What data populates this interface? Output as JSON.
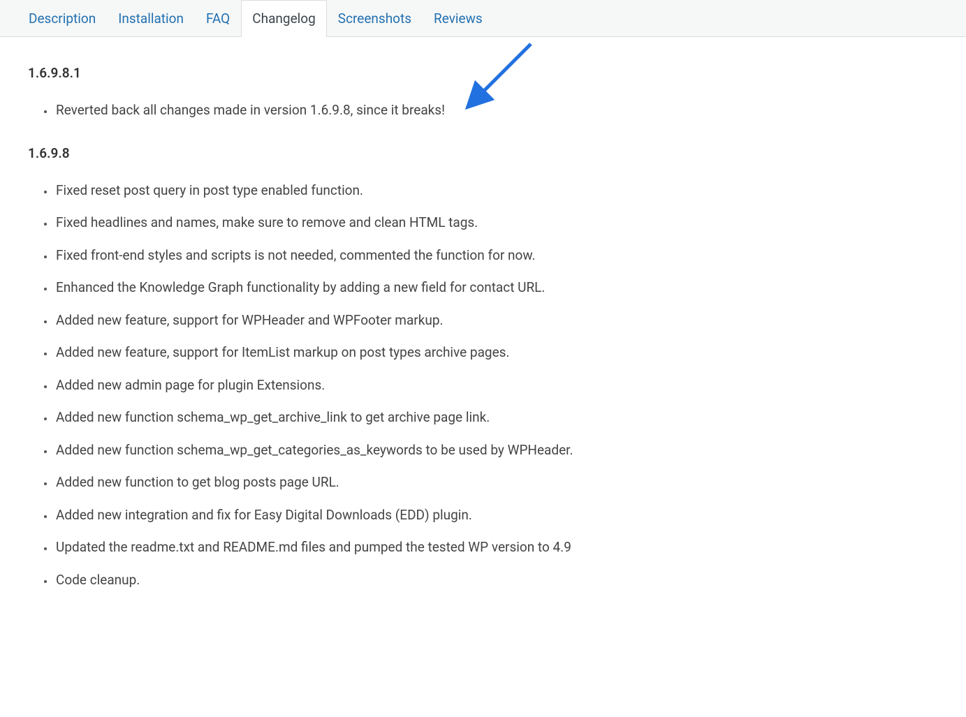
{
  "tabs": [
    {
      "label": "Description",
      "active": false
    },
    {
      "label": "Installation",
      "active": false
    },
    {
      "label": "FAQ",
      "active": false
    },
    {
      "label": "Changelog",
      "active": true
    },
    {
      "label": "Screenshots",
      "active": false
    },
    {
      "label": "Reviews",
      "active": false
    }
  ],
  "versions": [
    {
      "version": "1.6.9.8.1",
      "changes": [
        "Reverted back all changes made in version 1.6.9.8, since it breaks!"
      ]
    },
    {
      "version": "1.6.9.8",
      "changes": [
        "Fixed reset post query in post type enabled function.",
        "Fixed headlines and names, make sure to remove and clean HTML tags.",
        "Fixed front-end styles and scripts is not needed, commented the function for now.",
        "Enhanced the Knowledge Graph functionality by adding a new field for contact URL.",
        "Added new feature, support for WPHeader and WPFooter markup.",
        "Added new feature, support for ItemList markup on post types archive pages.",
        "Added new admin page for plugin Extensions.",
        "Added new function schema_wp_get_archive_link to get archive page link.",
        "Added new function schema_wp_get_categories_as_keywords to be used by WPHeader.",
        "Added new function to get blog posts page URL.",
        "Added new integration and fix for Easy Digital Downloads (EDD) plugin.",
        "Updated the readme.txt and README.md files and pumped the tested WP version to 4.9",
        "Code cleanup."
      ]
    }
  ]
}
